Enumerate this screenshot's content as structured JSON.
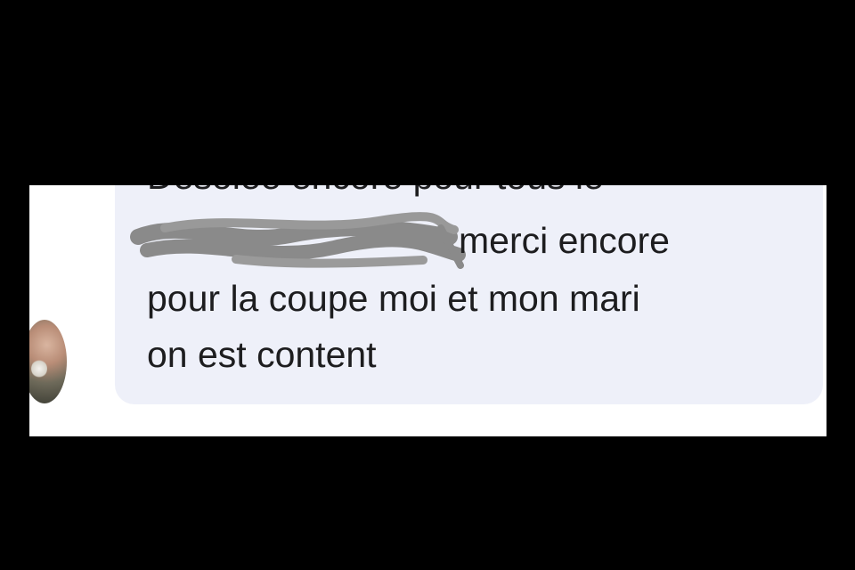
{
  "message": {
    "line_1_cut": "Désolée encore pour tous le",
    "line_2_visible": "merci encore",
    "line_3": "pour la coupe moi et mon mari",
    "line_4": "on est content",
    "redacted": true
  },
  "colors": {
    "background": "#000000",
    "panel": "#ffffff",
    "bubble": "#eef0f9",
    "text": "#1d1d1f",
    "redaction": "#8a8a8a"
  },
  "icons": {
    "avatar": "profile-photo"
  }
}
